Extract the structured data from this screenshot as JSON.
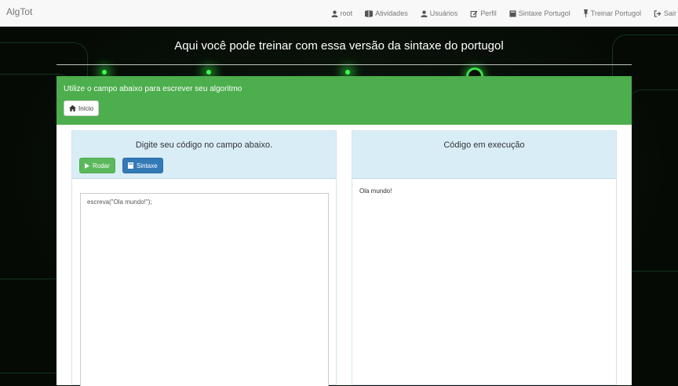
{
  "navbar": {
    "brand": "AlgTot",
    "items": [
      {
        "label": "root",
        "icon": "user-icon"
      },
      {
        "label": "Atividades",
        "icon": "book-icon"
      },
      {
        "label": "Usuários",
        "icon": "user-icon"
      },
      {
        "label": "Perfil",
        "icon": "edit-icon"
      },
      {
        "label": "Sintaxe Portugol",
        "icon": "book-icon"
      },
      {
        "label": "Treinar Portugol",
        "icon": "pin-icon"
      },
      {
        "label": "Sair",
        "icon": "logout-icon"
      }
    ]
  },
  "page": {
    "heading": "Aqui você pode treinar com essa versão da sintaxe do portugol"
  },
  "panel": {
    "title": "Utilize o campo abaixo para escrever seu algoritmo",
    "home_button": "Início"
  },
  "editor_card": {
    "title": "Digite seu código no campo abaixo.",
    "run_button": "Rodar",
    "syntax_button": "Sintaxe",
    "code": "escreva(\"Ola mundo!\");"
  },
  "output_card": {
    "title": "Código em execução",
    "output": "Ola mundo!"
  },
  "colors": {
    "panel_green": "#4cae4c",
    "run_green": "#5cb85c",
    "syntax_blue": "#337ab7",
    "card_header": "#d9edf7"
  }
}
